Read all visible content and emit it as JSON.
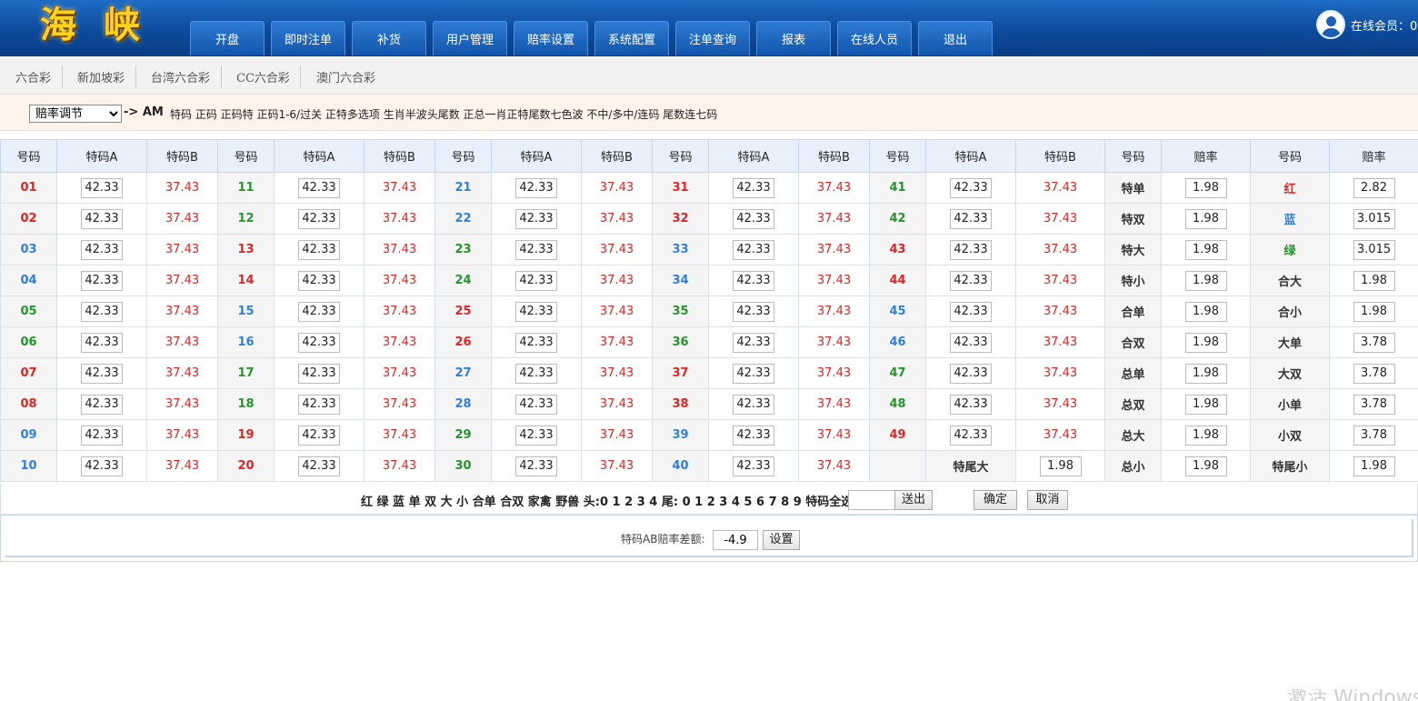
{
  "header": {
    "logo": "海 峡",
    "nav": [
      "开盘",
      "即时注单",
      "补货",
      "用户管理",
      "赔率设置",
      "系统配置",
      "注单查询",
      "报表",
      "在线人员",
      "退出"
    ],
    "online_label": "在线会员：0"
  },
  "subnav": [
    "六合彩",
    "新加坡彩",
    "台湾六合彩",
    "CC六合彩",
    "澳门六合彩"
  ],
  "oddsbar": {
    "select_value": "赔率调节",
    "arrow_label": "-> AM",
    "links": "特码 正码 正码特 正码1-6/过关 正特多选项 生肖半波头尾数 正总一肖正特尾数七色波 不中/多中/连码 尾数连七码"
  },
  "table": {
    "headers": [
      "号码",
      "特码A",
      "特码B",
      "号码",
      "特码A",
      "特码B",
      "号码",
      "特码A",
      "特码B",
      "号码",
      "特码A",
      "特码B",
      "号码",
      "特码A",
      "特码B",
      "号码",
      "赔率",
      "号码",
      "赔率"
    ],
    "odds_a": "42.33",
    "odds_b": "37.43",
    "rows": [
      [
        {
          "n": "01",
          "c": "red"
        },
        {
          "n": "11",
          "c": "green"
        },
        {
          "n": "21",
          "c": "blue"
        },
        {
          "n": "31",
          "c": "red"
        },
        {
          "n": "41",
          "c": "green"
        },
        {
          "n": "特单",
          "r": "1.98"
        },
        {
          "n": "红",
          "c": "red",
          "r": "2.82"
        }
      ],
      [
        {
          "n": "02",
          "c": "red"
        },
        {
          "n": "12",
          "c": "green"
        },
        {
          "n": "22",
          "c": "blue"
        },
        {
          "n": "32",
          "c": "red"
        },
        {
          "n": "42",
          "c": "green"
        },
        {
          "n": "特双",
          "r": "1.98"
        },
        {
          "n": "蓝",
          "c": "blue",
          "r": "3.015"
        }
      ],
      [
        {
          "n": "03",
          "c": "blue"
        },
        {
          "n": "13",
          "c": "red"
        },
        {
          "n": "23",
          "c": "green"
        },
        {
          "n": "33",
          "c": "blue"
        },
        {
          "n": "43",
          "c": "red"
        },
        {
          "n": "特大",
          "r": "1.98"
        },
        {
          "n": "绿",
          "c": "green",
          "r": "3.015"
        }
      ],
      [
        {
          "n": "04",
          "c": "blue"
        },
        {
          "n": "14",
          "c": "red"
        },
        {
          "n": "24",
          "c": "green"
        },
        {
          "n": "34",
          "c": "blue"
        },
        {
          "n": "44",
          "c": "red"
        },
        {
          "n": "特小",
          "r": "1.98"
        },
        {
          "n": "合大",
          "r": "1.98"
        }
      ],
      [
        {
          "n": "05",
          "c": "green"
        },
        {
          "n": "15",
          "c": "blue"
        },
        {
          "n": "25",
          "c": "red"
        },
        {
          "n": "35",
          "c": "green"
        },
        {
          "n": "45",
          "c": "blue"
        },
        {
          "n": "合单",
          "r": "1.98"
        },
        {
          "n": "合小",
          "r": "1.98"
        }
      ],
      [
        {
          "n": "06",
          "c": "green"
        },
        {
          "n": "16",
          "c": "blue"
        },
        {
          "n": "26",
          "c": "red"
        },
        {
          "n": "36",
          "c": "green"
        },
        {
          "n": "46",
          "c": "blue"
        },
        {
          "n": "合双",
          "r": "1.98"
        },
        {
          "n": "大单",
          "r": "3.78"
        }
      ],
      [
        {
          "n": "07",
          "c": "red"
        },
        {
          "n": "17",
          "c": "green"
        },
        {
          "n": "27",
          "c": "blue"
        },
        {
          "n": "37",
          "c": "red"
        },
        {
          "n": "47",
          "c": "green"
        },
        {
          "n": "总单",
          "r": "1.98"
        },
        {
          "n": "大双",
          "r": "3.78"
        }
      ],
      [
        {
          "n": "08",
          "c": "red"
        },
        {
          "n": "18",
          "c": "green"
        },
        {
          "n": "28",
          "c": "blue"
        },
        {
          "n": "38",
          "c": "red"
        },
        {
          "n": "48",
          "c": "green"
        },
        {
          "n": "总双",
          "r": "1.98"
        },
        {
          "n": "小单",
          "r": "3.78"
        }
      ],
      [
        {
          "n": "09",
          "c": "blue"
        },
        {
          "n": "19",
          "c": "red"
        },
        {
          "n": "29",
          "c": "green"
        },
        {
          "n": "39",
          "c": "blue"
        },
        {
          "n": "49",
          "c": "red"
        },
        {
          "n": "总大",
          "r": "1.98"
        },
        {
          "n": "小双",
          "r": "3.78"
        }
      ],
      [
        {
          "n": "10",
          "c": "blue"
        },
        {
          "n": "20",
          "c": "red"
        },
        {
          "n": "30",
          "c": "green"
        },
        {
          "n": "40",
          "c": "blue"
        },
        {
          "n": "",
          "c": "dark",
          "label": "特尾大",
          "r": "1.98"
        },
        {
          "n": "总小",
          "r": "1.98"
        },
        {
          "n": "特尾小",
          "r": "1.98"
        }
      ]
    ]
  },
  "quickrow": {
    "text": "红 绿 蓝 单 双 大 小 合单 合双 家禽 野兽 头:0 1 2 3 4 尾: 0 1 2 3 4 5 6 7 8 9 特码全选 赔率:",
    "input_value": "",
    "send_label": "送出",
    "confirm_label": "确定",
    "cancel_label": "取消"
  },
  "abrow": {
    "label": "特码AB赔率差额:",
    "value": "-4.9",
    "set_label": "设置"
  },
  "watermark": "激活 Windows",
  "colors": {
    "header_top": "#1f6cc4",
    "header_bottom": "#0a3f86",
    "logo": "#ffd21e",
    "ball_red": "#e02424",
    "ball_blue": "#2f7fe0",
    "ball_green": "#23952a"
  }
}
